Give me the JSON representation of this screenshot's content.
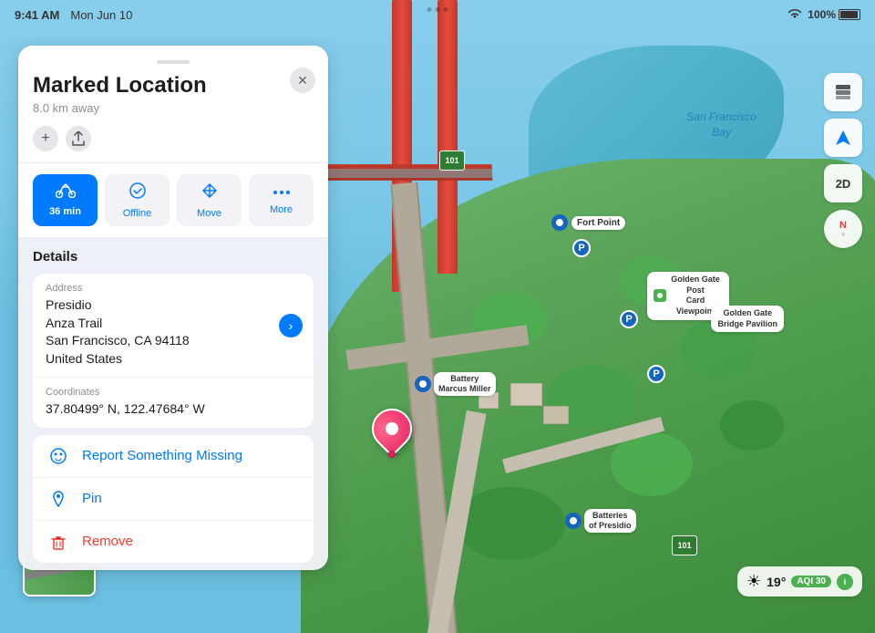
{
  "statusBar": {
    "time": "9:41 AM",
    "date": "Mon Jun 10",
    "battery": "100%"
  },
  "topDots": [
    "dot1",
    "dot2",
    "dot3"
  ],
  "panel": {
    "title": "Marked Location",
    "subtitle": "8.0 km away",
    "dragHandle": "",
    "addLabel": "+",
    "shareLabel": "⬆",
    "closeLabel": "✕",
    "actionButtons": [
      {
        "id": "bike",
        "icon": "🚴",
        "label": "36 min",
        "active": true
      },
      {
        "id": "offline",
        "icon": "✓",
        "label": "Offline",
        "active": false
      },
      {
        "id": "move",
        "icon": "↑",
        "label": "Move",
        "active": false
      },
      {
        "id": "more",
        "icon": "•••",
        "label": "More",
        "active": false
      }
    ],
    "detailsTitle": "Details",
    "address": {
      "label": "Address",
      "line1": "Presidio",
      "line2": "Anza Trail",
      "line3": "San Francisco, CA  94118",
      "line4": "United States"
    },
    "coordinates": {
      "label": "Coordinates",
      "value": "37.80499° N, 122.47684° W"
    },
    "actions": [
      {
        "id": "report",
        "icon": "🔍",
        "label": "Report Something Missing",
        "color": "blue"
      },
      {
        "id": "pin",
        "icon": "📌",
        "label": "Pin",
        "color": "blue"
      },
      {
        "id": "remove",
        "icon": "🗑",
        "label": "Remove",
        "color": "red"
      }
    ]
  },
  "map": {
    "labels": {
      "sfBayLine1": "San Francisco",
      "sfBayLine2": "Bay",
      "goldenGate": "Golden",
      "fortPoint": "Fort Point",
      "batteryMarcus1": "Battery",
      "batteryMarcus2": "Marcus Miller",
      "batteriesPresidio1": "Batteries",
      "batteriesPresidio2": "of Presidio",
      "ggPostcard1": "Golden Gate Post",
      "ggPostcard2": "Card Viewpoint",
      "ggBridgePavillon1": "Golden Gate",
      "ggBridgePavillon2": "Bridge Pavilion"
    },
    "highway101": "101"
  },
  "mapControls": [
    {
      "id": "layers",
      "icon": "🗺",
      "label": "Layers"
    },
    {
      "id": "navigate",
      "icon": "➤",
      "label": "Navigate"
    },
    {
      "id": "2d",
      "label": "2D",
      "isText": true
    }
  ],
  "weather": {
    "icon": "☀",
    "temp": "19°",
    "aqiLabel": "AQI 30"
  }
}
